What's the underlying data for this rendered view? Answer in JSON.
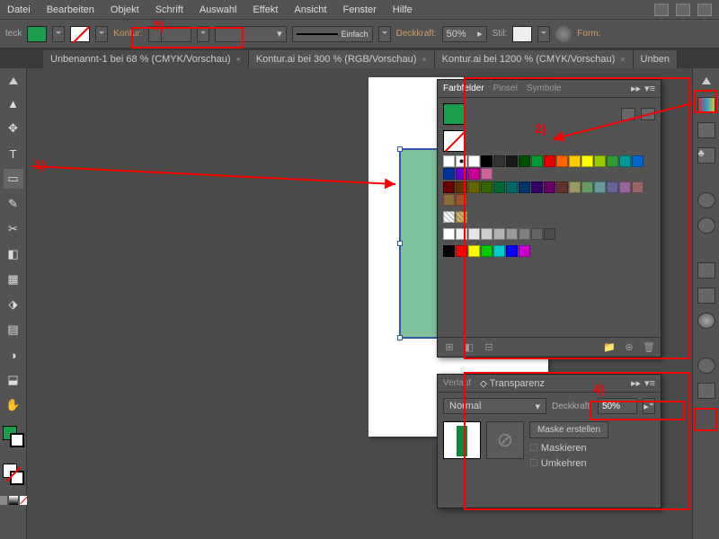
{
  "menu": [
    "Datei",
    "Bearbeiten",
    "Objekt",
    "Schrift",
    "Auswahl",
    "Effekt",
    "Ansicht",
    "Fenster",
    "Hilfe"
  ],
  "control": {
    "teck": "teck",
    "fill": "#1a9e4b",
    "kontur": "Kontur:",
    "stroke_style": "Einfach",
    "deckkraft_lbl": "Deckkraft:",
    "deckkraft_val": "50%",
    "stil": "Stil:",
    "form": "Form:"
  },
  "tabs": [
    {
      "label": "Unbenannt-1 bei 68 % (CMYK/Vorschau)",
      "active": true
    },
    {
      "label": "Kontur.ai bei 300 % (RGB/Vorschau)",
      "active": false
    },
    {
      "label": "Kontur.ai bei 1200 % (CMYK/Vorschau)",
      "active": false
    },
    {
      "label": "Unben",
      "active": false
    }
  ],
  "tools": [
    "▲",
    "✥",
    "T",
    "▭",
    "✎",
    "✂",
    "◧",
    "▦",
    "⬗",
    "▤",
    "◑",
    "⬓",
    "✋"
  ],
  "swatch_panel": {
    "tabs": [
      "Farbfelder",
      "Pinsel",
      "Symbole"
    ],
    "colors_row1": [
      "#ffffff",
      "#000000",
      "#333333",
      "#1a1a1a",
      "#004d00",
      "#009933",
      "#e60000",
      "#ff6600",
      "#ffcc00",
      "#ffff00",
      "#99cc00",
      "#339933",
      "#009999",
      "#0066cc",
      "#003399",
      "#6600cc",
      "#cc0099",
      "#cc6699"
    ],
    "colors_row2": [
      "#660000",
      "#663300",
      "#666600",
      "#336600",
      "#006633",
      "#006666",
      "#003366",
      "#330066",
      "#660066",
      "#663333",
      "#999966",
      "#669966",
      "#669999",
      "#666699",
      "#996699",
      "#996666",
      "#8a6d3b",
      "#a0522d"
    ],
    "colors_row3": [
      "#ffffff",
      "#f2f2f2",
      "#e6e6e6",
      "#cccccc",
      "#b3b3b3",
      "#999999",
      "#808080",
      "#666666",
      "#4d4d4d"
    ],
    "colors_row4": [
      "#000000",
      "#ff0000",
      "#ffff00",
      "#00cc00",
      "#00cccc",
      "#0000ff",
      "#cc00cc"
    ]
  },
  "trans_panel": {
    "tabs": [
      "Verlauf",
      "Transparenz"
    ],
    "mode": "Normal",
    "deck_lbl": "Deckkraft:",
    "deck_val": "50%",
    "mask_btn": "Maske erstellen",
    "mask_opt1": "Maskieren",
    "mask_opt2": "Umkehren"
  },
  "annotations": {
    "a1": "1)",
    "a2": "2)",
    "a3": "3)",
    "a4": "4)"
  }
}
